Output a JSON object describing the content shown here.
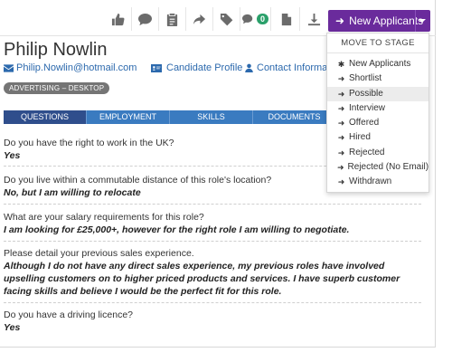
{
  "toolbar": {
    "icons": [
      "thumbs-up-icon",
      "comment-icon",
      "clipboard-icon",
      "share-icon",
      "tag-icon",
      "chat-icon",
      "document-icon",
      "download-icon"
    ],
    "chat_badge": "0",
    "stage_button_label": "New Applicants",
    "stage_button_color": "#6a2b9c"
  },
  "candidate": {
    "name": "Philip Nowlin",
    "email": "Philip.Nowlin@hotmail.com",
    "profile_link": "Candidate Profile",
    "contact_link": "Contact Informatio",
    "tag": "ADVERTISING – DESKTOP"
  },
  "tabs": [
    "QUESTIONS",
    "EMPLOYMENT",
    "SKILLS",
    "DOCUMENTS",
    ""
  ],
  "questions": [
    {
      "q": "Do you have the right to work in the UK?",
      "a": "Yes"
    },
    {
      "q": "Do you live within a commutable distance of this role's location?",
      "a": "No, but I am willing to relocate"
    },
    {
      "q": "What are your salary requirements for this role?",
      "a": "I am looking for £25,000+, however for the right role I am willing to negotiate."
    },
    {
      "q": "Please detail your previous sales experience.",
      "a": "Although I do not have any direct sales experience, my previous roles have involved upselling customers on to higher priced products and services. I have superb customer facing skills and believe I would be the perfect fit for this role."
    },
    {
      "q": "Do you have a driving licence?",
      "a": "Yes"
    }
  ],
  "dropdown": {
    "header": "MOVE TO STAGE",
    "items": [
      {
        "label": "New Applicants",
        "icon": "asterisk-icon"
      },
      {
        "label": "Shortlist",
        "icon": "arrow-right-icon"
      },
      {
        "label": "Possible",
        "icon": "arrow-right-icon"
      },
      {
        "label": "Interview",
        "icon": "arrow-right-icon"
      },
      {
        "label": "Offered",
        "icon": "arrow-right-icon"
      },
      {
        "label": "Hired",
        "icon": "arrow-right-icon"
      },
      {
        "label": "Rejected",
        "icon": "arrow-right-icon"
      },
      {
        "label": "Rejected (No Email)",
        "icon": "arrow-right-icon"
      },
      {
        "label": "Withdrawn",
        "icon": "arrow-right-icon"
      }
    ]
  }
}
